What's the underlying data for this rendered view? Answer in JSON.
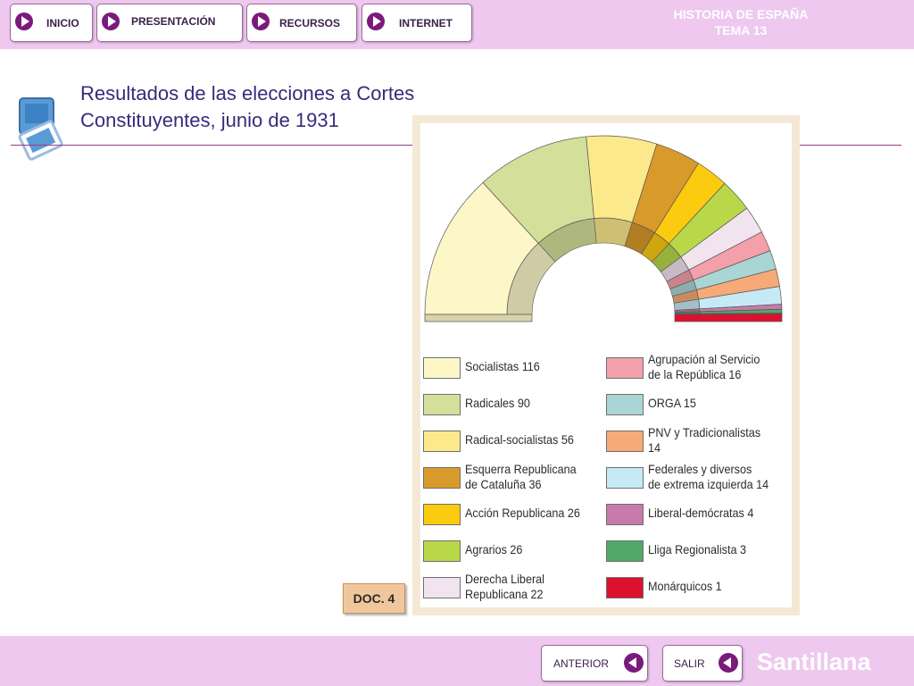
{
  "nav": {
    "inicio": "INICIO",
    "presentacion": "PRESENTACIÓN",
    "recursos": "RECURSOS",
    "internet": "INTERNET"
  },
  "header": {
    "title_line1": "HISTORIA DE ESPAÑA",
    "title_line2": "TEMA 13"
  },
  "slide": {
    "title_line1": "Resultados de las elecciones a Cortes",
    "title_line2": "Constituyentes, junio de 1931"
  },
  "doc_label": "DOC. 4",
  "chart_data": {
    "type": "pie",
    "subtype": "hemicycle",
    "parties": [
      {
        "name": "Socialistas",
        "seats": 116,
        "color": "#fdf7c8"
      },
      {
        "name": "Radicales",
        "seats": 90,
        "color": "#d4df9a"
      },
      {
        "name": "Radical-socialistas",
        "seats": 56,
        "color": "#fbe98c"
      },
      {
        "name": "Esquerra Republicana de Cataluña",
        "seats": 36,
        "color": "#d89a2a"
      },
      {
        "name": "Acción Republicana",
        "seats": 26,
        "color": "#fbcb10"
      },
      {
        "name": "Agrarios",
        "seats": 26,
        "color": "#b8d84a"
      },
      {
        "name": "Derecha Liberal Republicana",
        "seats": 22,
        "color": "#f2e4ef"
      },
      {
        "name": "Agrupación al Servicio de la República",
        "seats": 16,
        "color": "#f4a0aa"
      },
      {
        "name": "ORGA",
        "seats": 15,
        "color": "#a9d6d4"
      },
      {
        "name": "PNV y Tradicionalistas",
        "seats": 14,
        "color": "#f5aa78"
      },
      {
        "name": "Federales y diversos de extrema izquierda",
        "seats": 14,
        "color": "#c6e9f6"
      },
      {
        "name": "Liberal-demócratas",
        "seats": 4,
        "color": "#c87aab"
      },
      {
        "name": "Lliga Regionalista",
        "seats": 3,
        "color": "#52a868"
      },
      {
        "name": "Monárquicos",
        "seats": 1,
        "color": "#dd1030"
      }
    ],
    "legend": {
      "left": [
        {
          "line1": "Socialistas 116",
          "line2": "",
          "color": "#fdf7c8"
        },
        {
          "line1": "Radicales 90",
          "line2": "",
          "color": "#d4df9a"
        },
        {
          "line1": "Radical-socialistas 56",
          "line2": "",
          "color": "#fbe98c"
        },
        {
          "line1": "Esquerra Republicana",
          "line2": "de Cataluña 36",
          "color": "#d89a2a"
        },
        {
          "line1": "Acción Republicana 26",
          "line2": "",
          "color": "#fbcb10"
        },
        {
          "line1": "Agrarios 26",
          "line2": "",
          "color": "#b8d84a"
        },
        {
          "line1": "Derecha Liberal",
          "line2": "Republicana 22",
          "color": "#f2e4ef"
        }
      ],
      "right": [
        {
          "line1": "Agrupación al Servicio",
          "line2": "de la República 16",
          "color": "#f4a0aa"
        },
        {
          "line1": "ORGA 15",
          "line2": "",
          "color": "#a9d6d4"
        },
        {
          "line1": "PNV y Tradicionalistas",
          "line2": "14",
          "color": "#f5aa78"
        },
        {
          "line1": "Federales y diversos",
          "line2": "de extrema izquierda 14",
          "color": "#c6e9f6"
        },
        {
          "line1": "Liberal-demócratas 4",
          "line2": "",
          "color": "#c87aab"
        },
        {
          "line1": "Lliga Regionalista 3",
          "line2": "",
          "color": "#52a868"
        },
        {
          "line1": "Monárquicos 1",
          "line2": "",
          "color": "#dd1030"
        }
      ]
    }
  },
  "footer": {
    "anterior": "ANTERIOR",
    "salir": "SALIR",
    "brand": "Santillana"
  }
}
